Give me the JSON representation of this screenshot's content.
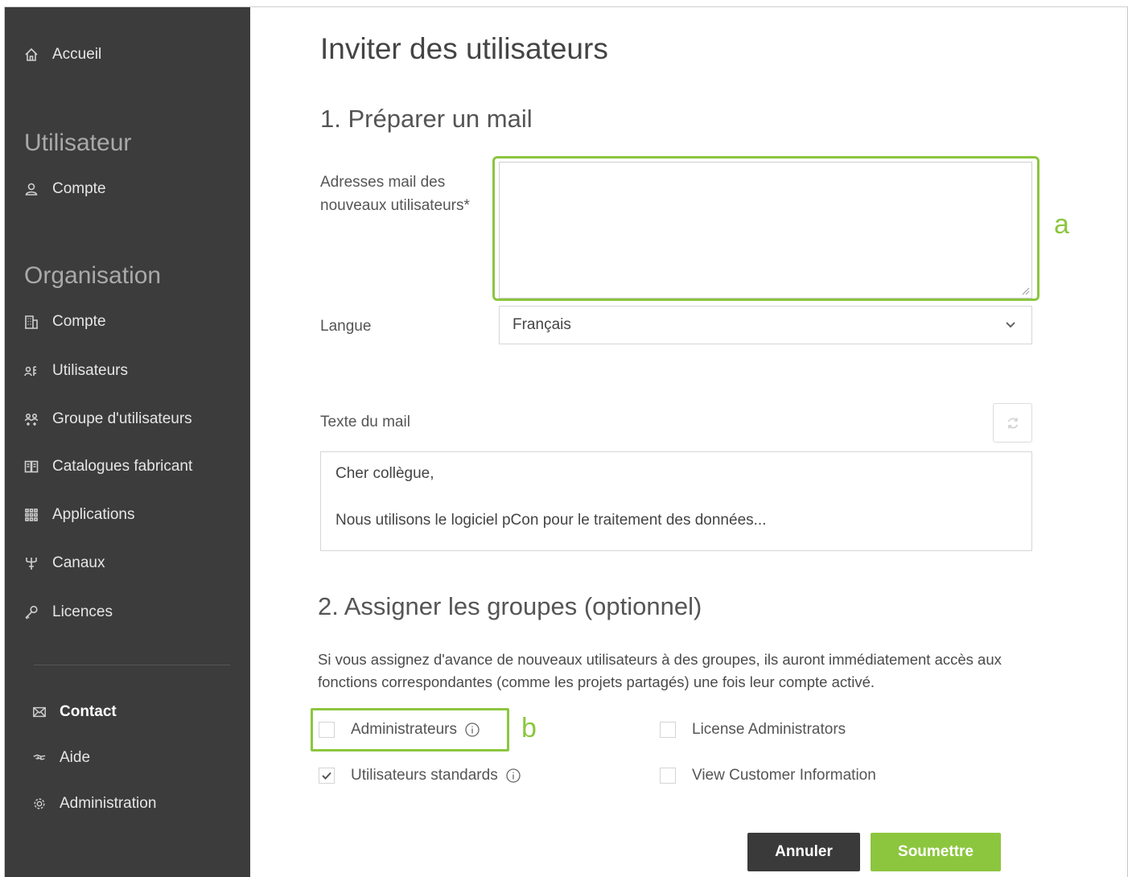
{
  "sidebar": {
    "home": {
      "label": "Accueil",
      "icon": "home-icon"
    },
    "user_section": {
      "title": "Utilisateur",
      "items": [
        {
          "label": "Compte",
          "icon": "user-icon"
        }
      ]
    },
    "org_section": {
      "title": "Organisation",
      "items": [
        {
          "label": "Compte",
          "icon": "building-icon"
        },
        {
          "label": "Utilisateurs",
          "icon": "users-icon"
        },
        {
          "label": "Groupe d'utilisateurs",
          "icon": "user-group-icon"
        },
        {
          "label": "Catalogues fabricant",
          "icon": "catalog-icon"
        },
        {
          "label": "Applications",
          "icon": "apps-grid-icon"
        },
        {
          "label": "Canaux",
          "icon": "channels-icon"
        },
        {
          "label": "Licences",
          "icon": "key-icon"
        }
      ]
    },
    "bottom": [
      {
        "label": "Contact",
        "icon": "mail-icon"
      },
      {
        "label": "Aide",
        "icon": "help-icon"
      },
      {
        "label": "Administration",
        "icon": "gear-icon"
      }
    ]
  },
  "main": {
    "title": "Inviter des utilisateurs",
    "step1": {
      "title": "1. Préparer un mail",
      "email_label_line1": "Adresses mail des",
      "email_label_line2": "nouveaux utilisateurs*",
      "email_value": "",
      "language_label": "Langue",
      "language_value": "Français",
      "mail_text_label": "Texte du mail",
      "mail_text_line1": "Cher collègue,",
      "mail_text_line2": "Nous utilisons le logiciel pCon pour le traitement des données..."
    },
    "step2": {
      "title": "2. Assigner les groupes (optionnel)",
      "description": "Si vous assignez d'avance de nouveaux utilisateurs à des groupes, ils auront immédiatement accès aux fonctions correspondantes (comme les projets partagés) une fois leur compte activé.",
      "groups": [
        {
          "label": "Administrateurs",
          "checked": false,
          "info": true
        },
        {
          "label": "Utilisateurs standards",
          "checked": true,
          "info": true
        },
        {
          "label": "License Administrators",
          "checked": false,
          "info": false
        },
        {
          "label": "View Customer Information",
          "checked": false,
          "info": false
        }
      ]
    },
    "buttons": {
      "cancel": "Annuler",
      "submit": "Soumettre"
    }
  },
  "annotations": {
    "a": "a",
    "b": "b"
  },
  "colors": {
    "sidebar_bg": "#3c3c3c",
    "accent": "#8cc63f",
    "cancel_bg": "#3a3a3a"
  }
}
